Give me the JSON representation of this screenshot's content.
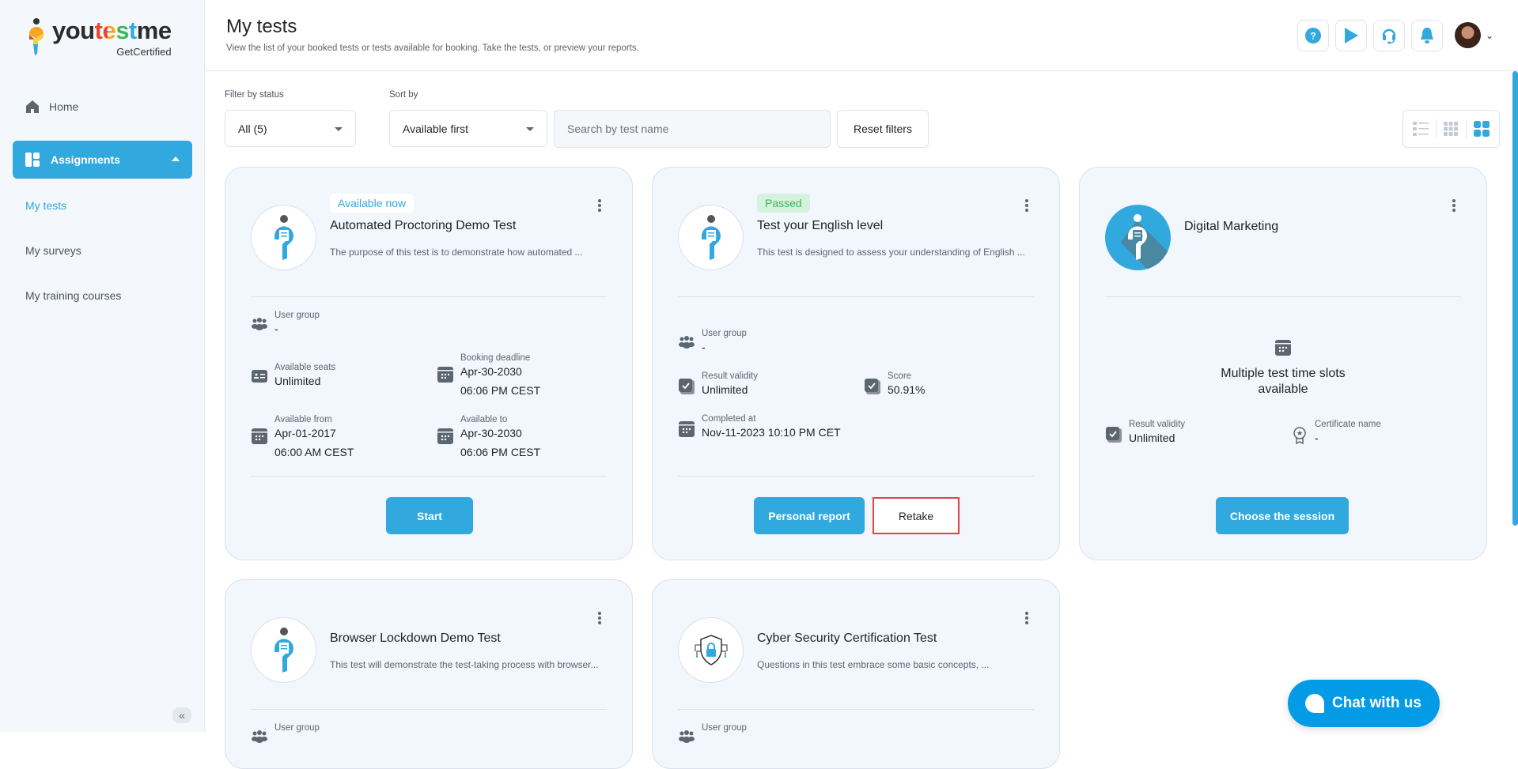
{
  "brand": {
    "name_parts": [
      "you",
      "test",
      "me"
    ],
    "sub": "GetCertified"
  },
  "sidebar": {
    "home": "Home",
    "assignments": "Assignments",
    "subitems": [
      {
        "label": "My tests",
        "active": true
      },
      {
        "label": "My surveys",
        "active": false
      },
      {
        "label": "My training courses",
        "active": false
      }
    ],
    "collapse_icon": "«"
  },
  "header": {
    "title": "My tests",
    "subtitle": "View the list of your booked tests or tests available for booking. Take the tests, or preview your reports.",
    "icons": [
      "help-icon",
      "play-icon",
      "headset-icon",
      "bell-icon"
    ]
  },
  "filters": {
    "status_label": "Filter by status",
    "status_value": "All (5)",
    "sort_label": "Sort by",
    "sort_value": "Available first",
    "search_placeholder": "Search by test name",
    "search_value": "",
    "reset_label": "Reset filters",
    "view_modes": [
      "list",
      "compact-grid",
      "card-grid"
    ],
    "active_view": "card-grid"
  },
  "colors": {
    "accent": "#31a9de",
    "passed": "#3bb65b",
    "highlight": "#e24444",
    "chat": "#039be5"
  },
  "cards": [
    {
      "badge": "Available now",
      "title": "Automated Proctoring Demo Test",
      "description": "The purpose of this test is to demonstrate how automated ...",
      "fields": {
        "user_group": {
          "label": "User group",
          "value": "-"
        },
        "seats": {
          "label": "Available seats",
          "value": "Unlimited"
        },
        "deadline": {
          "label": "Booking deadline",
          "value1": "Apr-30-2030",
          "value2": "06:06 PM CEST"
        },
        "from": {
          "label": "Available from",
          "value1": "Apr-01-2017",
          "value2": "06:00 AM CEST"
        },
        "to": {
          "label": "Available to",
          "value1": "Apr-30-2030",
          "value2": "06:06 PM CEST"
        }
      },
      "primary_button": "Start"
    },
    {
      "badge": "Passed",
      "title": "Test your English level",
      "description": "This test is designed to assess your understanding of English ...",
      "fields": {
        "user_group": {
          "label": "User group",
          "value": "-"
        },
        "validity": {
          "label": "Result validity",
          "value": "Unlimited"
        },
        "score": {
          "label": "Score",
          "value": "50.91%"
        },
        "completed": {
          "label": "Completed at",
          "value": "Nov-11-2023 10:10 PM CET"
        }
      },
      "primary_button": "Personal report",
      "secondary_button": "Retake"
    },
    {
      "title": "Digital Marketing",
      "multi_slots": "Multiple test time slots available",
      "fields": {
        "validity": {
          "label": "Result validity",
          "value": "Unlimited"
        },
        "certificate": {
          "label": "Certificate name",
          "value": "-"
        }
      },
      "primary_button": "Choose the session"
    },
    {
      "title": "Browser Lockdown Demo Test",
      "description": "This test will demonstrate the test-taking process with browser...",
      "fields": {
        "user_group": {
          "label": "User group"
        }
      }
    },
    {
      "title": "Cyber Security Certification Test",
      "description": "Questions in this test embrace some basic concepts, ...",
      "fields": {
        "user_group": {
          "label": "User group"
        }
      }
    }
  ],
  "chat": {
    "label": "Chat with us"
  }
}
